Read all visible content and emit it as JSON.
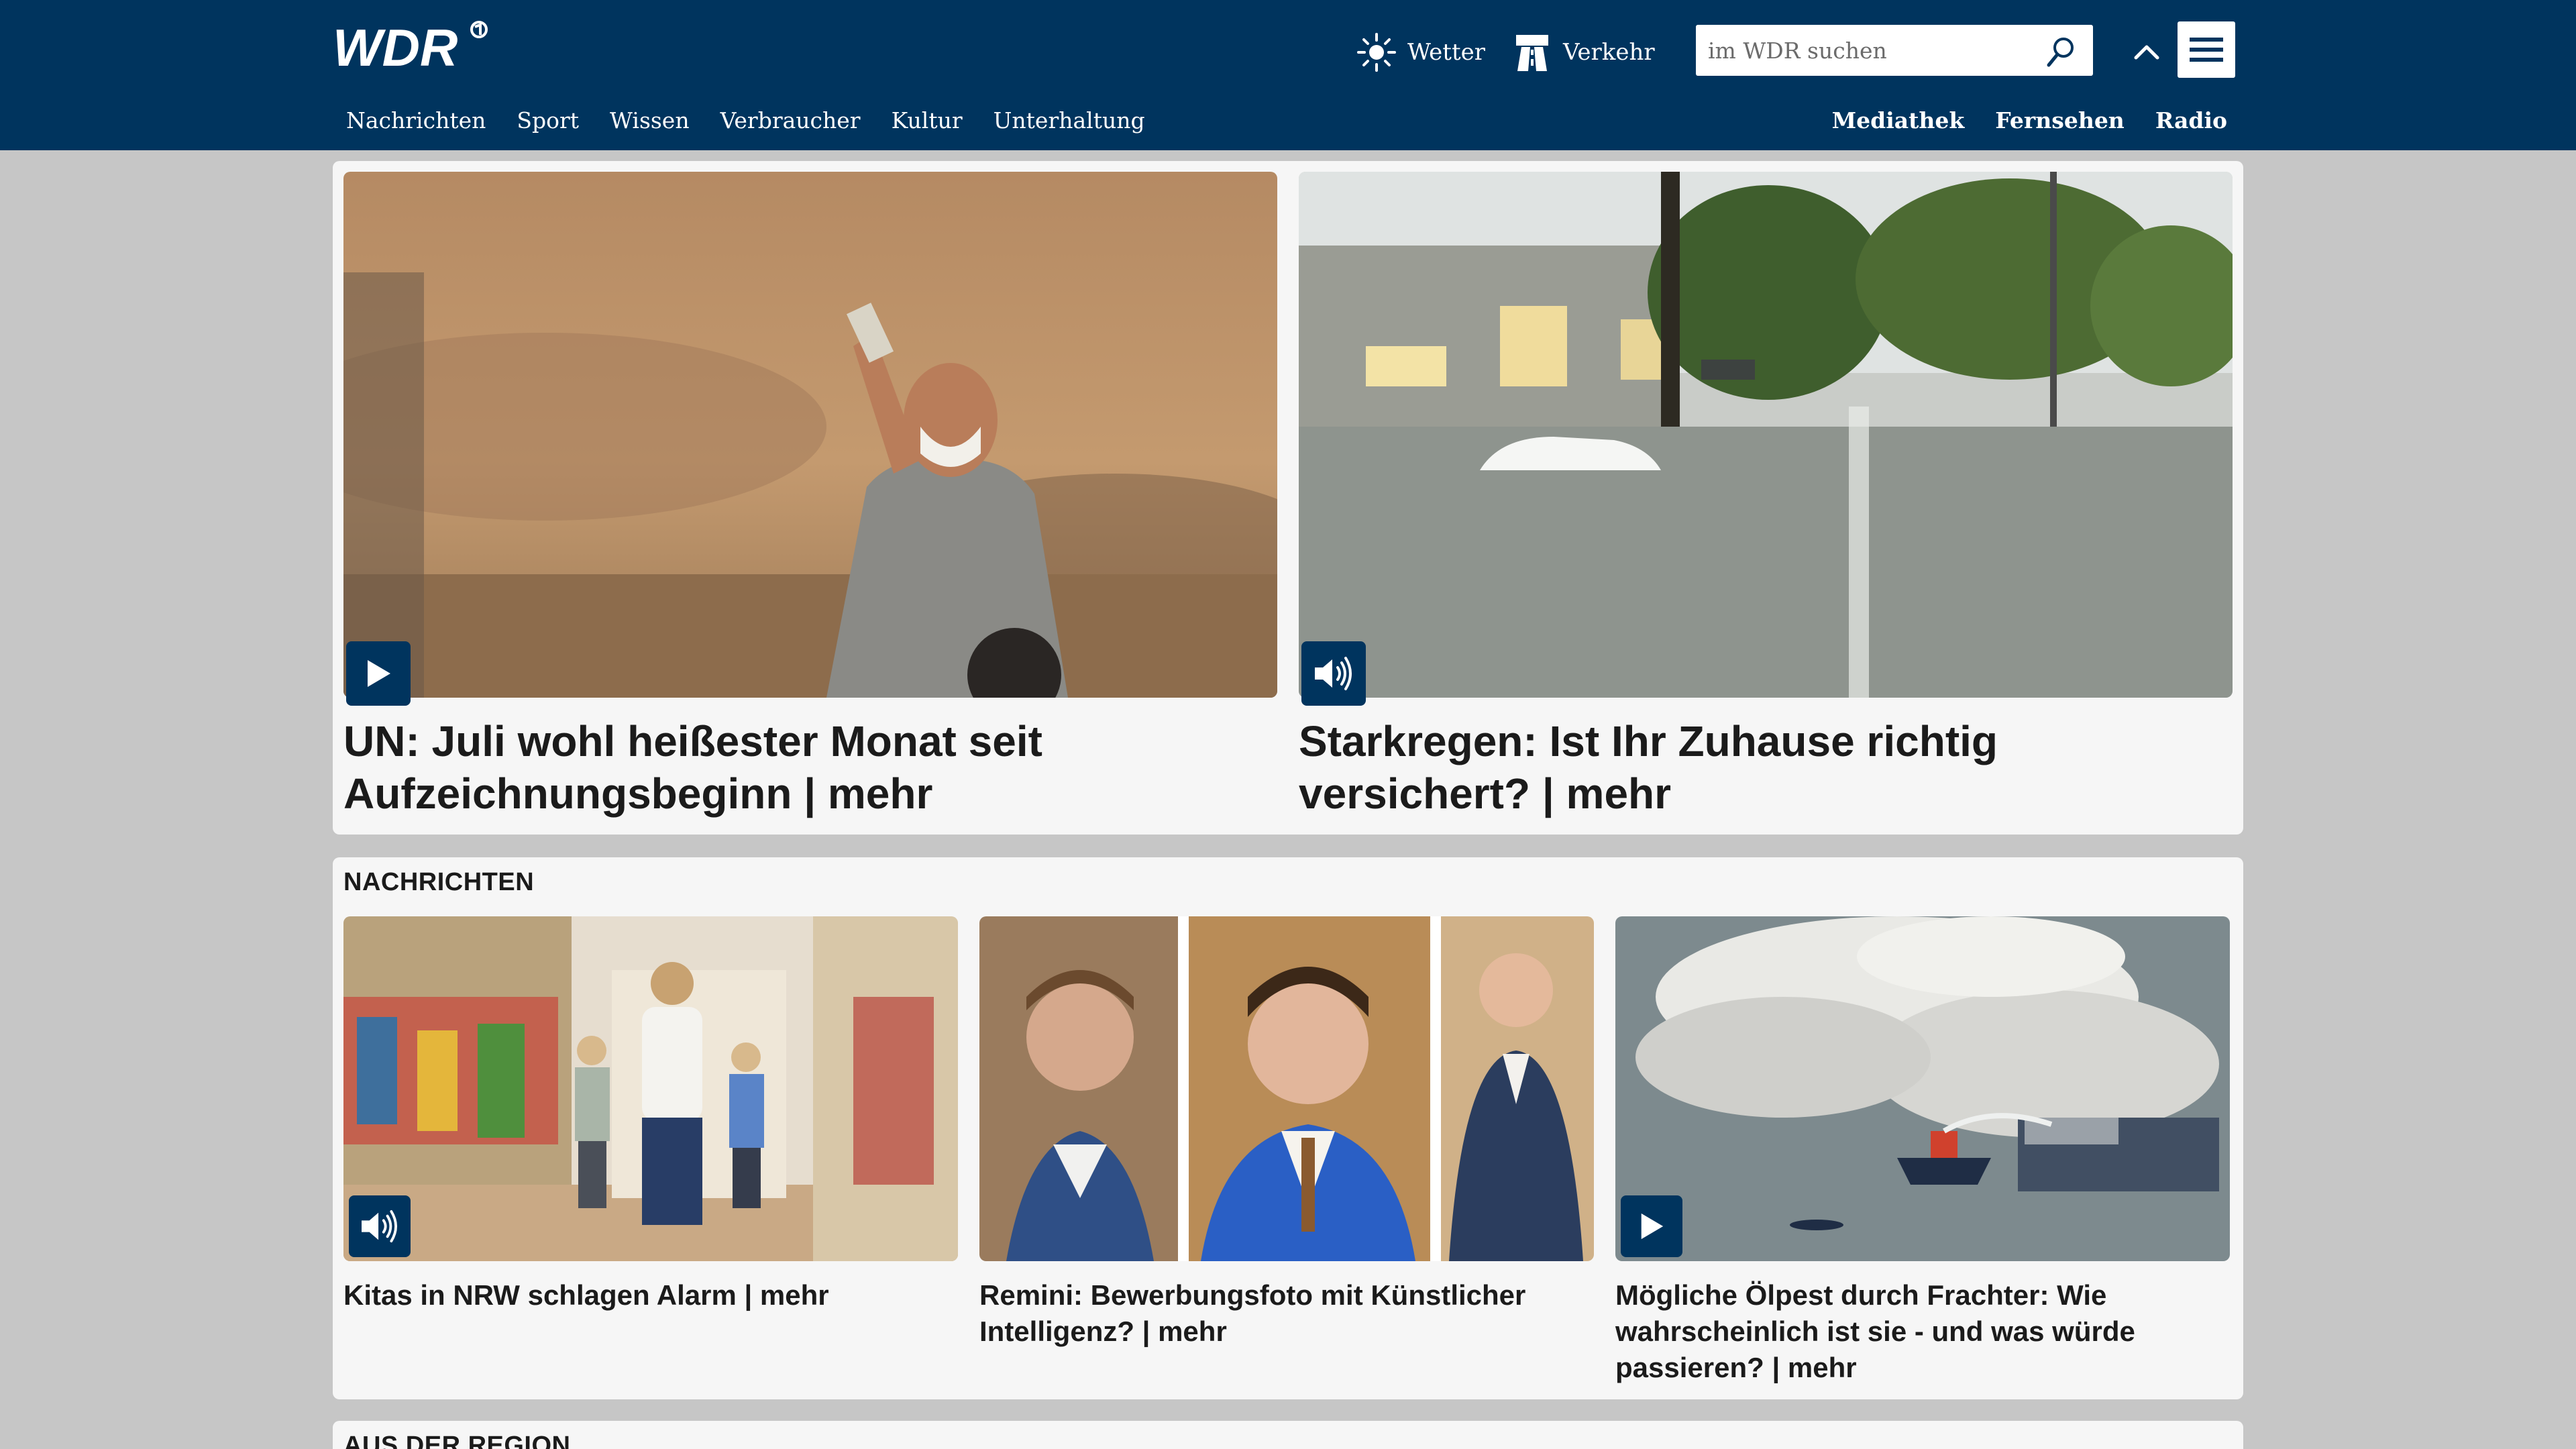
{
  "header": {
    "logo_text": "WDR",
    "weather_label": "Wetter",
    "traffic_label": "Verkehr",
    "search": {
      "placeholder": "im WDR suchen"
    },
    "main_nav": [
      "Nachrichten",
      "Sport",
      "Wissen",
      "Verbraucher",
      "Kultur",
      "Unterhaltung"
    ],
    "service_nav": [
      "Mediathek",
      "Fernsehen",
      "Radio"
    ]
  },
  "top_teasers": [
    {
      "headline": "UN: Juli wohl heißester Monat seit Aufzeichnungsbeginn | mehr",
      "media": "play-icon"
    },
    {
      "headline": "Starkregen: Ist Ihr Zuhause richtig versichert? | mehr",
      "media": "audio-icon"
    }
  ],
  "news_section": {
    "title": "NACHRICHTEN",
    "teasers": [
      {
        "headline": "Kitas in NRW schlagen Alarm | mehr",
        "media": "audio-icon"
      },
      {
        "headline": "Remini: Bewerbungsfoto mit Künstlicher Intelligenz? | mehr",
        "media": "none"
      },
      {
        "headline": "Mögliche Ölpest durch Frachter: Wie wahrscheinlich ist sie - und was würde passieren? | mehr",
        "media": "play-icon"
      }
    ]
  },
  "region_section": {
    "title": "AUS DER REGION"
  },
  "colors": {
    "brand": "#00345e",
    "background": "#c6c6c6",
    "card": "#f6f6f6"
  }
}
